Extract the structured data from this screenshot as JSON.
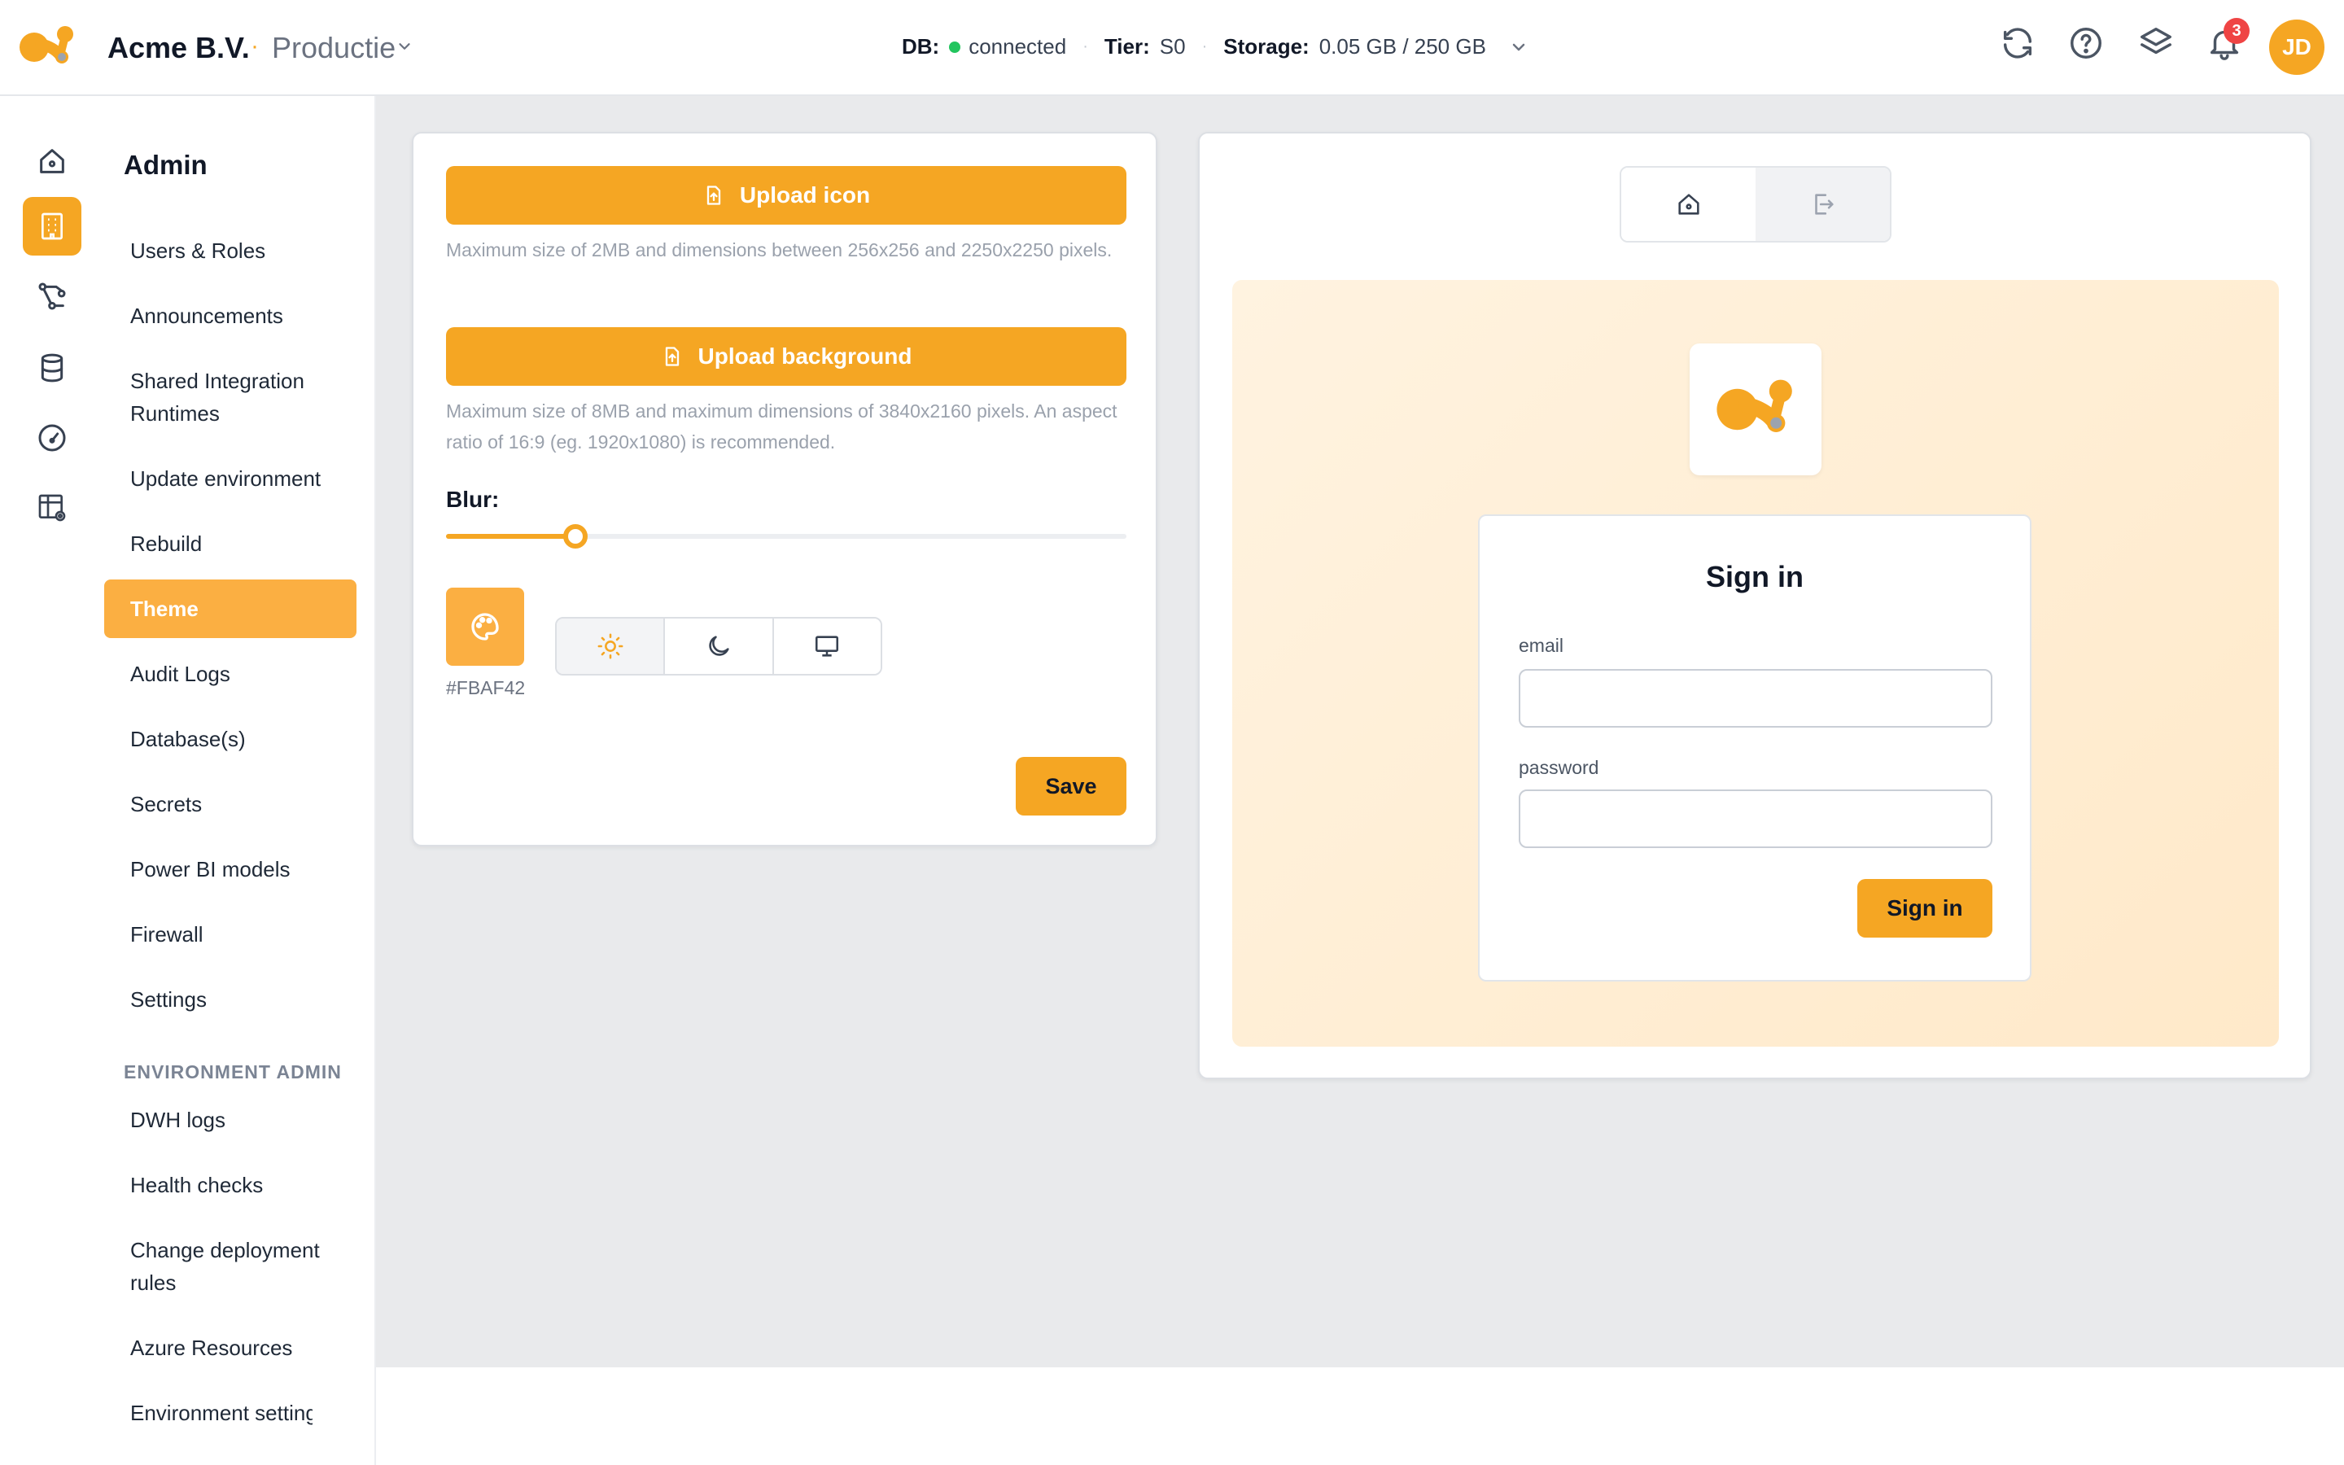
{
  "header": {
    "org_name": "Acme B.V.",
    "separator": "·",
    "environment": "Productie",
    "db_label": "DB:",
    "db_status": "connected",
    "tier_label": "Tier:",
    "tier_value": "S0",
    "storage_label": "Storage:",
    "storage_value": "0.05 GB / 250 GB",
    "notification_count": "3",
    "avatar_initials": "JD"
  },
  "nav": {
    "title": "Admin",
    "items": [
      {
        "label": "Users & Roles"
      },
      {
        "label": "Announcements"
      },
      {
        "label": "Shared Integration Runtimes"
      },
      {
        "label": "Update environment"
      },
      {
        "label": "Rebuild"
      },
      {
        "label": "Theme"
      },
      {
        "label": "Audit Logs"
      },
      {
        "label": "Database(s)"
      },
      {
        "label": "Secrets"
      },
      {
        "label": "Power BI models"
      },
      {
        "label": "Firewall"
      },
      {
        "label": "Settings"
      }
    ],
    "section_title": "ENVIRONMENT ADMIN",
    "env_items": [
      {
        "label": "DWH logs"
      },
      {
        "label": "Health checks"
      },
      {
        "label": "Change deployment rules"
      },
      {
        "label": "Azure Resources"
      },
      {
        "label": "Environment settings"
      }
    ]
  },
  "theme_form": {
    "upload_icon_label": "Upload icon",
    "upload_icon_help": "Maximum size of 2MB and dimensions between 256x256 and 2250x2250 pixels.",
    "upload_background_label": "Upload background",
    "upload_background_help": "Maximum size of 8MB and maximum dimensions of 3840x2160 pixels. An aspect ratio of 16:9 (eg. 1920x1080) is recommended.",
    "blur_label": "Blur:",
    "blur_value": 0.19,
    "color_hex": "#FBAF42",
    "selected_mode": "light",
    "save_label": "Save"
  },
  "preview": {
    "selected_view": "home",
    "signin_title": "Sign in",
    "email_label": "email",
    "password_label": "password",
    "signin_button": "Sign in"
  },
  "colors": {
    "accent": "#F5A623",
    "theme": "#FBAF42",
    "status_ok": "#22C55E",
    "badge": "#EF4444"
  }
}
